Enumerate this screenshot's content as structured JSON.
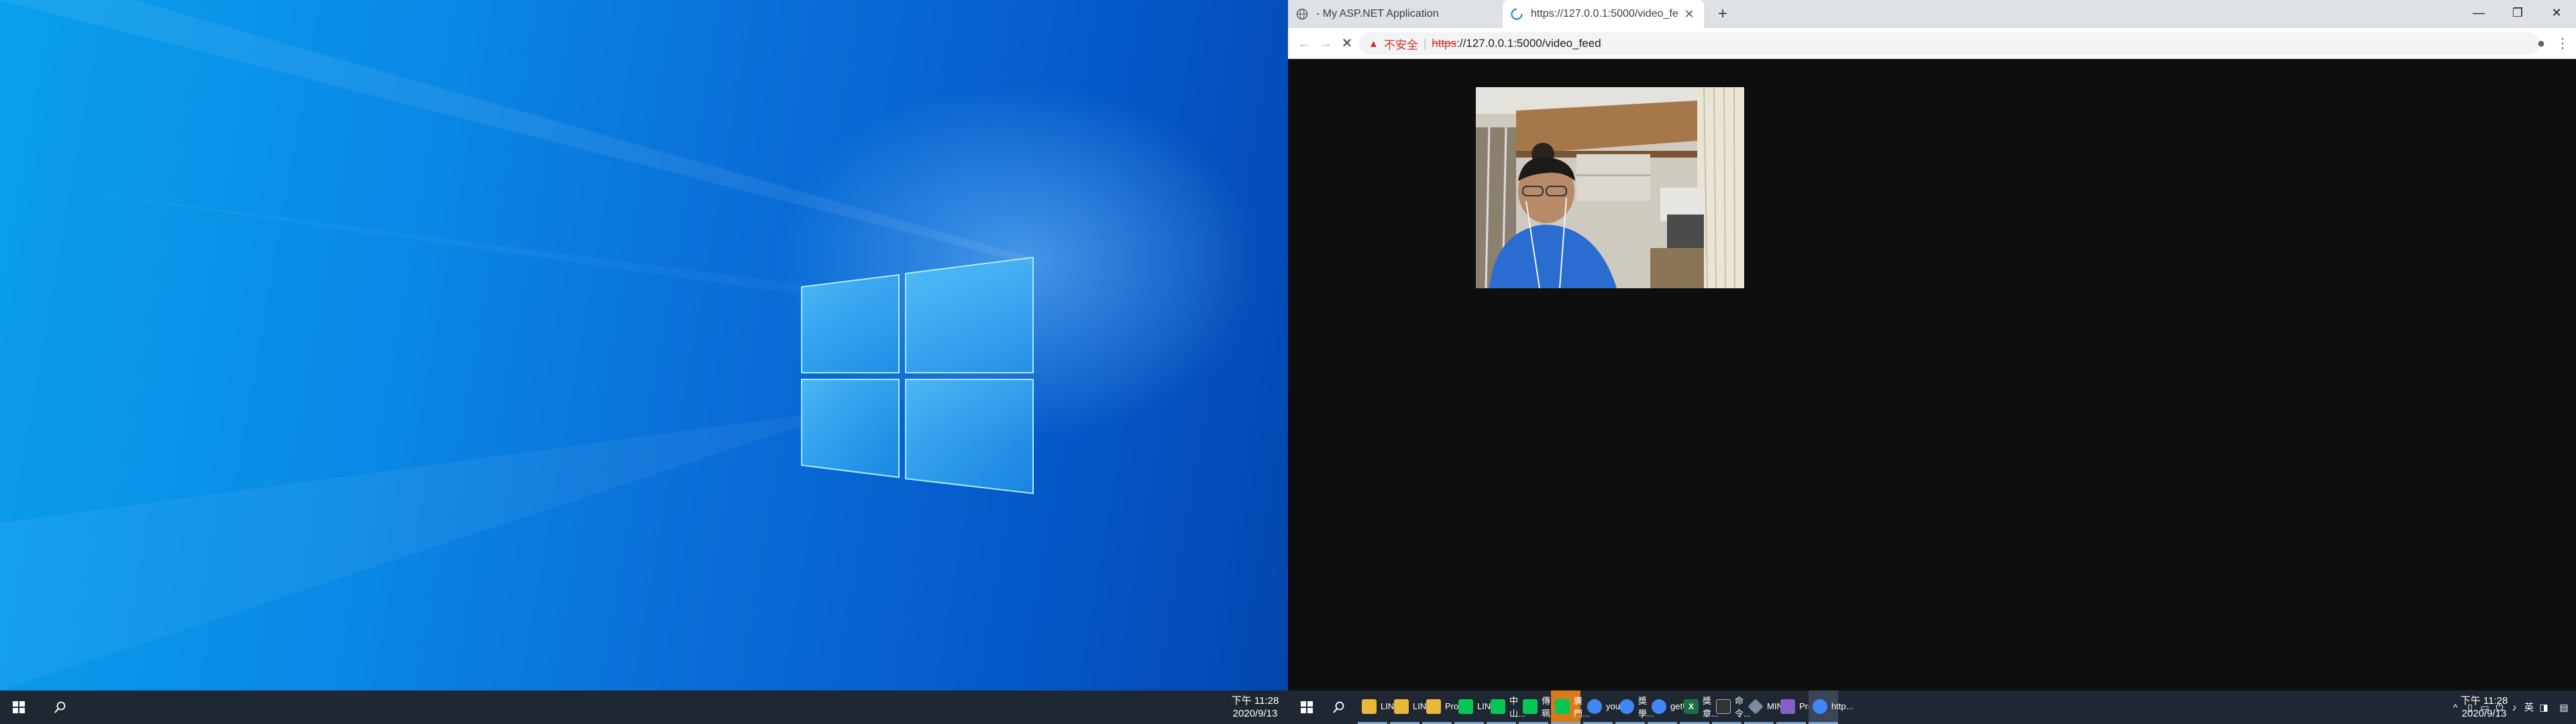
{
  "left_clock": {
    "time": "下午 11:28",
    "date": "2020/9/13"
  },
  "right_clock": {
    "time": "下午 11:28",
    "date": "2020/9/13"
  },
  "browser": {
    "tabs": [
      {
        "title": "- My ASP.NET Application",
        "icon": "globe-icon"
      },
      {
        "title": "https://127.0.0.1:5000/video_fe",
        "icon": "loading-icon"
      }
    ],
    "address_bar": {
      "security_label": "不安全",
      "scheme": "https",
      "rest": "://127.0.0.1:5000/video_feed"
    }
  },
  "taskbar_apps": [
    {
      "label": "LINE...",
      "icon": "folder-icon",
      "color": "#e8b93a"
    },
    {
      "label": "LINE...",
      "icon": "folder-icon",
      "color": "#e8b93a"
    },
    {
      "label": "Proj...",
      "icon": "folder-icon",
      "color": "#e8b93a"
    },
    {
      "label": "LINE",
      "icon": "line-icon",
      "color": "#06c755"
    },
    {
      "label": "中山...",
      "icon": "contact-icon",
      "color": "#06c755"
    },
    {
      "label": "傳珮...",
      "icon": "contact-icon",
      "color": "#06c755"
    },
    {
      "label": "廣門...",
      "icon": "contact-icon",
      "color": "#06c755"
    },
    {
      "label": "you...",
      "icon": "chrome-icon",
      "color": "#4285f4"
    },
    {
      "label": "獎學...",
      "icon": "chrome-icon",
      "color": "#4285f4"
    },
    {
      "label": "getU...",
      "icon": "chrome-icon",
      "color": "#4285f4"
    },
    {
      "label": "獎章...",
      "icon": "excel-icon",
      "color": "#1d6f42"
    },
    {
      "label": "命令...",
      "icon": "terminal-icon",
      "color": "#333333"
    },
    {
      "label": "MIN...",
      "icon": "app-icon",
      "color": "#7c8a9e"
    },
    {
      "label": "Proj...",
      "icon": "vs-icon",
      "color": "#865fc5"
    },
    {
      "label": "http...",
      "icon": "chrome-icon",
      "color": "#4285f4"
    }
  ]
}
